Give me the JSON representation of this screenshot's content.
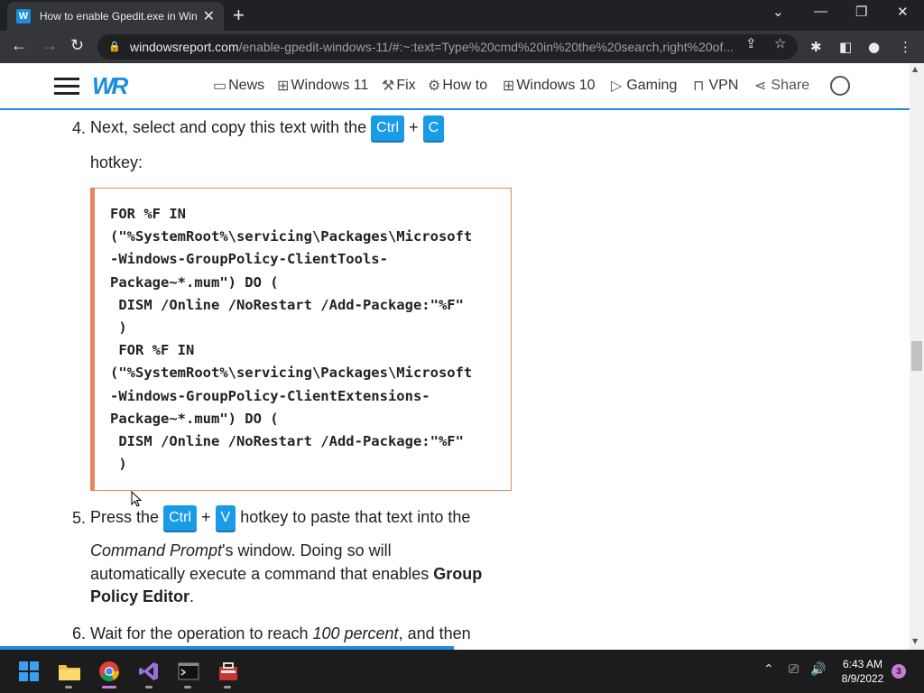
{
  "browser": {
    "tab_title": "How to enable Gpedit.exe in Win",
    "tab_favicon": "W",
    "url_domain": "windowsreport.com",
    "url_path": "/enable-gpedit-windows-11/#:~:text=Type%20cmd%20in%20the%20search,right%20of..."
  },
  "site": {
    "logo": "WR",
    "nav": [
      {
        "label": "News",
        "icon": "chat-icon"
      },
      {
        "label": "Windows 11",
        "icon": "windows-icon"
      },
      {
        "label": "Fix",
        "icon": "wrench-icon"
      },
      {
        "label": "How to",
        "icon": "gear-icon"
      },
      {
        "label": "Windows 10",
        "icon": "windows-icon"
      },
      {
        "label": "Gaming",
        "icon": "play-icon"
      },
      {
        "label": "VPN",
        "icon": "lock-icon"
      },
      {
        "label": "Share",
        "icon": "share-icon"
      }
    ]
  },
  "article": {
    "step4": {
      "num": "4.",
      "text_a": "Next, select and copy this text with the",
      "key1": "Ctrl",
      "plus": "+",
      "key2": "C",
      "text_b": "hotkey:"
    },
    "code": "FOR %F IN\n(\"%SystemRoot%\\servicing\\Packages\\Microsoft\n-Windows-GroupPolicy-ClientTools-\nPackage~*.mum\") DO (\n DISM /Online /NoRestart /Add-Package:\"%F\"\n )\n FOR %F IN\n(\"%SystemRoot%\\servicing\\Packages\\Microsoft\n-Windows-GroupPolicy-ClientExtensions-\nPackage~*.mum\") DO (\n DISM /Online /NoRestart /Add-Package:\"%F\"\n )",
    "step5": {
      "num": "5.",
      "text_a": "Press the",
      "key1": "Ctrl",
      "plus": "+",
      "key2": "V",
      "text_b": "hotkey to paste that text into the",
      "italic": "Command Prompt",
      "text_c": "'s window. Doing so will",
      "text_d": "automatically execute a command that enables",
      "bold1": "Group",
      "bold2": "Policy Editor",
      "end": "."
    },
    "step6": {
      "num": "6.",
      "text_a": "Wait for the operation to reach",
      "italic": "100 percent",
      "text_b": ", and then"
    }
  },
  "taskbar": {
    "apps": [
      "windows-start-icon",
      "file-explorer-icon",
      "chrome-icon",
      "visual-studio-icon",
      "terminal-icon",
      "toolbox-icon"
    ],
    "time": "6:43 AM",
    "date": "8/9/2022",
    "notifications": "3"
  },
  "colors": {
    "accent": "#1a8de0",
    "key_bg": "#1a9be6",
    "code_border": "#e0875a"
  }
}
